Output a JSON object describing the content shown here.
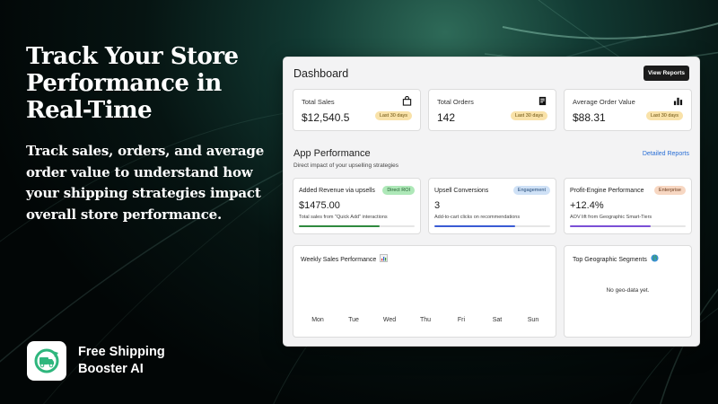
{
  "hero": {
    "title": "Track Your Store Performance in Real-Time",
    "subtitle": "Track sales, orders, and average order value to understand how your shipping strategies impact overall store performance."
  },
  "brand": {
    "name": "Free Shipping Booster AI",
    "logo_icon": "truck-arrow-icon",
    "accent": "#2eb67d"
  },
  "dashboard": {
    "title": "Dashboard",
    "view_reports_label": "View Reports",
    "stats": [
      {
        "label": "Total Sales",
        "value": "$12,540.5",
        "badge": "Last 30 days",
        "icon": "shopping-bag-icon"
      },
      {
        "label": "Total Orders",
        "value": "142",
        "badge": "Last 30 days",
        "icon": "receipt-icon"
      },
      {
        "label": "Average Order Value",
        "value": "$88.31",
        "badge": "Last 30 days",
        "icon": "bar-chart-icon"
      }
    ],
    "app_performance": {
      "title": "App Performance",
      "subtitle": "Direct impact of your upselling strategies",
      "detail_link": "Detailed Reports",
      "cards": [
        {
          "label": "Added Revenue via upsells",
          "badge": "Direct ROI",
          "value": "$1475.00",
          "note": "Total sales from \"Quick Add\" interactions",
          "progress": 0.7,
          "color": "#2f8a3e"
        },
        {
          "label": "Upsell Conversions",
          "badge": "Engagement",
          "value": "3",
          "note": "Add-to-cart clicks on recommendations",
          "progress": 0.7,
          "color": "#3a5bd4"
        },
        {
          "label": "Profit-Engine Performance",
          "badge": "Enterprise",
          "value": "+12.4%",
          "note": "AOV lift from Geographic Smart-Tiers",
          "progress": 0.7,
          "color": "#7b4fd6"
        }
      ]
    },
    "weekly_sales": {
      "title": "Weekly Sales Performance",
      "title_icon": "chart-emoji-icon",
      "days": [
        "Mon",
        "Tue",
        "Wed",
        "Thu",
        "Fri",
        "Sat",
        "Sun"
      ]
    },
    "geo": {
      "title": "Top Geographic Segments",
      "title_icon": "globe-icon",
      "empty_text": "No geo-data yet."
    }
  }
}
